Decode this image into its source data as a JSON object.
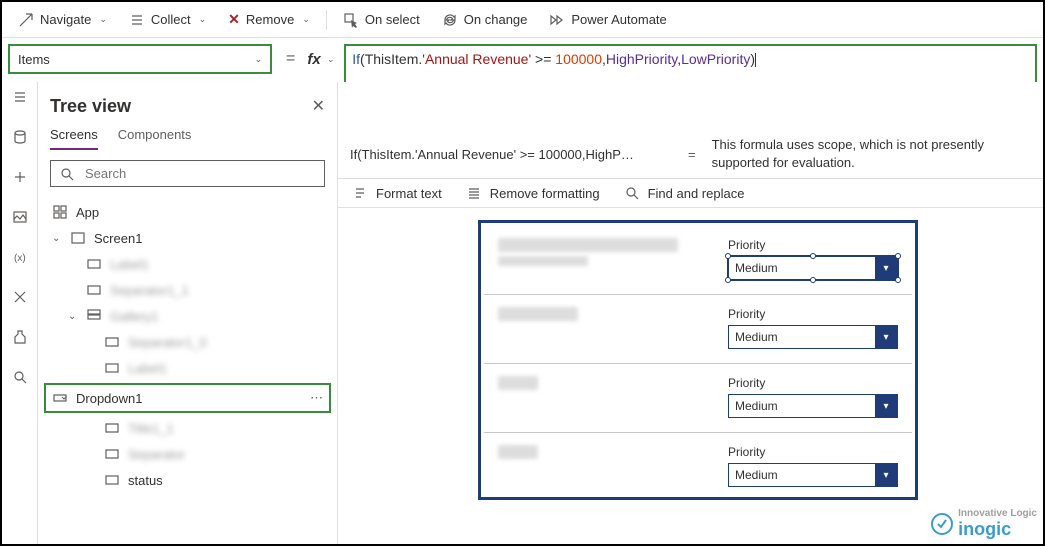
{
  "toolbar": {
    "navigate": "Navigate",
    "collect": "Collect",
    "remove": "Remove",
    "on_select": "On select",
    "on_change": "On change",
    "power_automate": "Power Automate"
  },
  "property_selector": {
    "value": "Items"
  },
  "formula": {
    "raw": "If(ThisItem.'Annual Revenue' >= 100000,HighPriority,LowPriority)",
    "tokens": [
      {
        "t": "If",
        "c": "tok-fn"
      },
      {
        "t": "(",
        "c": "tok-op"
      },
      {
        "t": "ThisItem",
        "c": "tok-op"
      },
      {
        "t": ".",
        "c": "tok-op"
      },
      {
        "t": "'Annual Revenue'",
        "c": "tok-str"
      },
      {
        "t": " >= ",
        "c": "tok-op"
      },
      {
        "t": "100000",
        "c": "tok-num"
      },
      {
        "t": ",",
        "c": "tok-op"
      },
      {
        "t": "HighPriority",
        "c": "tok-id"
      },
      {
        "t": ",",
        "c": "tok-op"
      },
      {
        "t": "LowPriority",
        "c": "tok-id"
      },
      {
        "t": ")",
        "c": "tok-op"
      }
    ]
  },
  "message": {
    "left": "If(ThisItem.'Annual Revenue' >= 100000,HighP…",
    "right": "This formula uses scope, which is not presently supported for evaluation."
  },
  "format_bar": {
    "format_text": "Format text",
    "remove_formatting": "Remove formatting",
    "find_replace": "Find and replace"
  },
  "tree": {
    "title": "Tree view",
    "tabs": {
      "screens": "Screens",
      "components": "Components"
    },
    "search_placeholder": "Search",
    "app": "App",
    "screen1": "Screen1",
    "dropdown1": "Dropdown1",
    "status": "status"
  },
  "gallery": {
    "priority_label": "Priority",
    "priority_value": "Medium"
  },
  "watermark": {
    "brand": "inogic",
    "tag": "Innovative Logic"
  }
}
